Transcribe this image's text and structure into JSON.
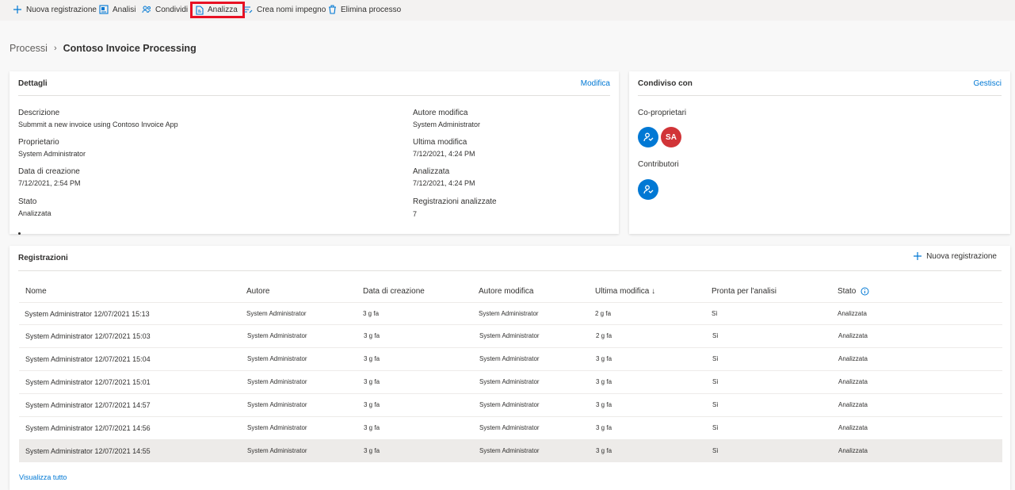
{
  "toolbar": {
    "new_recording": "Nuova registrazione",
    "analytics": "Analisi",
    "share": "Condividi",
    "analyze": "Analizza",
    "create_names": "Crea nomi impegno",
    "delete_process": "Elimina processo"
  },
  "breadcrumb": {
    "parent": "Processi",
    "current": "Contoso Invoice Processing"
  },
  "details": {
    "title": "Dettagli",
    "edit_link": "Modifica",
    "fields": [
      {
        "label": "Descrizione",
        "value": "Submmit a new invoice using Contoso Invoice App"
      },
      {
        "label": "Proprietario",
        "value": "System Administrator"
      },
      {
        "label": "Data di creazione",
        "value": "7/12/2021, 2:54 PM"
      },
      {
        "label": "Stato",
        "value": "Analizzata"
      },
      {
        "label": "Autore modifica",
        "value": "System Administrator"
      },
      {
        "label": "Ultima modifica",
        "value": "7/12/2021, 4:24 PM"
      },
      {
        "label": "Analizzata",
        "value": "7/12/2021, 4:24 PM"
      },
      {
        "label": "Registrazioni analizzate",
        "value": "7"
      }
    ]
  },
  "shared": {
    "title": "Condiviso con",
    "manage_link": "Gestisci",
    "co_owners_label": "Co-proprietari",
    "co_owner_initials": "SA",
    "contributors_label": "Contributori"
  },
  "recordings": {
    "title": "Registrazioni",
    "new_button": "Nuova registrazione",
    "columns": [
      "Nome",
      "Autore",
      "Data di creazione",
      "Autore modifica",
      "Ultima modifica ↓",
      "Pronta per l'analisi",
      "Stato"
    ],
    "rows": [
      [
        "System Administrator 12/07/2021 15:13",
        "System Administrator",
        "3 g fa",
        "System Administrator",
        "2 g fa",
        "Sì",
        "Analizzata"
      ],
      [
        "System Administrator 12/07/2021 15:03",
        "System Administrator",
        "3 g fa",
        "System Administrator",
        "2 g fa",
        "Sì",
        "Analizzata"
      ],
      [
        "System Administrator 12/07/2021 15:04",
        "System Administrator",
        "3 g fa",
        "System Administrator",
        "3 g fa",
        "Sì",
        "Analizzata"
      ],
      [
        "System Administrator 12/07/2021 15:01",
        "System Administrator",
        "3 g fa",
        "System Administrator",
        "3 g fa",
        "Sì",
        "Analizzata"
      ],
      [
        "System Administrator 12/07/2021 14:57",
        "System Administrator",
        "3 g fa",
        "System Administrator",
        "3 g fa",
        "Sì",
        "Analizzata"
      ],
      [
        "System Administrator 12/07/2021 14:56",
        "System Administrator",
        "3 g fa",
        "System Administrator",
        "3 g fa",
        "Sì",
        "Analizzata"
      ],
      [
        "System Administrator 12/07/2021 14:55",
        "System Administrator",
        "3 g fa",
        "System Administrator",
        "3 g fa",
        "Sì",
        "Analizzata"
      ]
    ],
    "view_all": "Visualizza tutto"
  },
  "colors": {
    "accent": "#0078d4",
    "avatar_red": "#d13438",
    "highlight": "#e81123"
  }
}
